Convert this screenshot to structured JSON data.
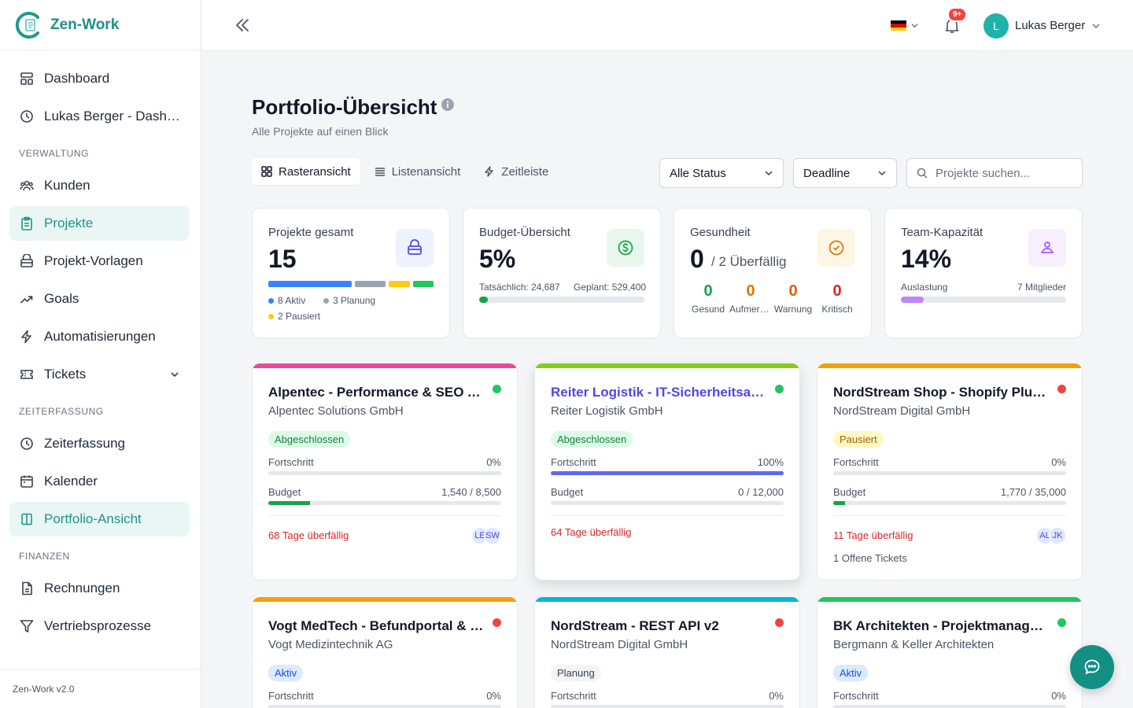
{
  "app": {
    "name": "Zen-Work",
    "version": "Zen-Work v2.0"
  },
  "sidebar": {
    "top_items": [
      {
        "label": "Dashboard",
        "icon": "dashboard-icon"
      },
      {
        "label": "Lukas Berger - Dashboard",
        "icon": "clock-icon"
      }
    ],
    "sections": [
      {
        "title": "VERWALTUNG",
        "items": [
          {
            "label": "Kunden",
            "icon": "users-icon"
          },
          {
            "label": "Projekte",
            "icon": "clipboard-icon",
            "active": true
          },
          {
            "label": "Projekt-Vorlagen",
            "icon": "template-icon"
          },
          {
            "label": "Goals",
            "icon": "trend-icon"
          },
          {
            "label": "Automatisierungen",
            "icon": "bolt-icon"
          },
          {
            "label": "Tickets",
            "icon": "ticket-icon",
            "expandable": true
          }
        ]
      },
      {
        "title": "ZEITERFASSUNG",
        "items": [
          {
            "label": "Zeiterfassung",
            "icon": "clock-icon"
          },
          {
            "label": "Kalender",
            "icon": "calendar-icon"
          },
          {
            "label": "Portfolio-Ansicht",
            "icon": "columns-icon",
            "active": true
          }
        ]
      },
      {
        "title": "FINANZEN",
        "items": [
          {
            "label": "Rechnungen",
            "icon": "document-icon"
          },
          {
            "label": "Vertriebsprozesse",
            "icon": "funnel-icon"
          }
        ]
      }
    ]
  },
  "header": {
    "user_initial": "L",
    "user_name": "Lukas Berger",
    "notification_badge": "9+",
    "language": "de"
  },
  "page": {
    "title": "Portfolio-Übersicht",
    "subtitle": "Alle Projekte auf einen Blick",
    "views": [
      {
        "label": "Rasteransicht",
        "icon": "grid-icon",
        "active": true
      },
      {
        "label": "Listenansicht",
        "icon": "list-icon"
      },
      {
        "label": "Zeitleiste",
        "icon": "bolt-icon"
      }
    ],
    "filters": {
      "status": "Alle Status",
      "sort": "Deadline",
      "search_placeholder": "Projekte suchen..."
    }
  },
  "stats": {
    "projects": {
      "label": "Projekte gesamt",
      "value": "15",
      "aktiv": "8 Aktiv",
      "planung": "3 Planung",
      "pausiert": "2 Pausiert"
    },
    "budget": {
      "label": "Budget-Übersicht",
      "value": "5%",
      "actual": "Tatsächlich: 24,687",
      "planned": "Geplant: 529,400",
      "progress": 5
    },
    "health": {
      "label": "Gesundheit",
      "value": "0",
      "overdue": "/ 2 Überfällig",
      "columns": [
        {
          "n": "0",
          "label": "Gesund",
          "color": "#16a34a"
        },
        {
          "n": "0",
          "label": "Aufmerksamkeit",
          "color": "#d97706"
        },
        {
          "n": "0",
          "label": "Warnung",
          "color": "#ea580c"
        },
        {
          "n": "0",
          "label": "Kritisch",
          "color": "#dc2626"
        }
      ]
    },
    "team": {
      "label": "Team-Kapazität",
      "value": "14%",
      "utilization_label": "Auslastung",
      "members": "7 Mitglieder",
      "progress": 14
    }
  },
  "projects": [
    {
      "title": "Alpentec - Performance & SEO Audit",
      "client": "Alpentec Solutions GmbH",
      "status": "Abgeschlossen",
      "status_bg": "#dcfce7",
      "status_color": "#15803d",
      "top_color": "#ec4899",
      "dot": "#22c55e",
      "progress_label": "Fortschritt",
      "progress_value": "0%",
      "progress": 0,
      "progress_color": "#6366f1",
      "budget_label": "Budget",
      "budget_value": "1,540 / 8,500",
      "budget": 18,
      "overdue": "68 Tage überfällig",
      "avatars": [
        "LE",
        "SW"
      ],
      "tickets": ""
    },
    {
      "title": "Reiter Logistik - IT-Sicherheitsaudit",
      "client": "Reiter Logistik GmbH",
      "status": "Abgeschlossen",
      "status_bg": "#dcfce7",
      "status_color": "#15803d",
      "top_color": "#84cc16",
      "dot": "#22c55e",
      "progress_label": "Fortschritt",
      "progress_value": "100%",
      "progress": 100,
      "progress_color": "#6366f1",
      "budget_label": "Budget",
      "budget_value": "0 / 12,000",
      "budget": 0,
      "overdue": "64 Tage überfällig",
      "avatars": [],
      "tickets": "",
      "link": true,
      "raised": true
    },
    {
      "title": "NordStream Shop - Shopify Plus Migration",
      "client": "NordStream Digital GmbH",
      "status": "Pausiert",
      "status_bg": "#fef9c3",
      "status_color": "#a16207",
      "top_color": "#f59e0b",
      "dot": "#ef4444",
      "progress_label": "Fortschritt",
      "progress_value": "0%",
      "progress": 0,
      "progress_color": "#6366f1",
      "budget_label": "Budget",
      "budget_value": "1,770 / 35,000",
      "budget": 5,
      "overdue": "11 Tage überfällig",
      "avatars": [
        "AL",
        "JK"
      ],
      "tickets": "1 Offene Tickets"
    },
    {
      "title": "Vogt MedTech - Befundportal & Video",
      "client": "Vogt Medizintechnik AG",
      "status": "Aktiv",
      "status_bg": "#dbeafe",
      "status_color": "#1d4ed8",
      "top_color": "#f59e0b",
      "dot": "#ef4444",
      "progress_label": "Fortschritt",
      "progress_value": "0%",
      "progress": 0,
      "progress_color": "#6366f1"
    },
    {
      "title": "NordStream - REST API v2",
      "client": "NordStream Digital GmbH",
      "status": "Planung",
      "status_bg": "#f3f4f6",
      "status_color": "#374151",
      "top_color": "#06b6d4",
      "dot": "#ef4444",
      "progress_label": "Fortschritt",
      "progress_value": "0%",
      "progress": 0,
      "progress_color": "#6366f1"
    },
    {
      "title": "BK Architekten - Projektmanagement",
      "client": "Bergmann & Keller Architekten",
      "status": "Aktiv",
      "status_bg": "#dbeafe",
      "status_color": "#1d4ed8",
      "top_color": "#22c55e",
      "dot": "#22c55e",
      "progress_label": "Fortschritt",
      "progress_value": "0%",
      "progress": 0,
      "progress_color": "#6366f1"
    }
  ]
}
